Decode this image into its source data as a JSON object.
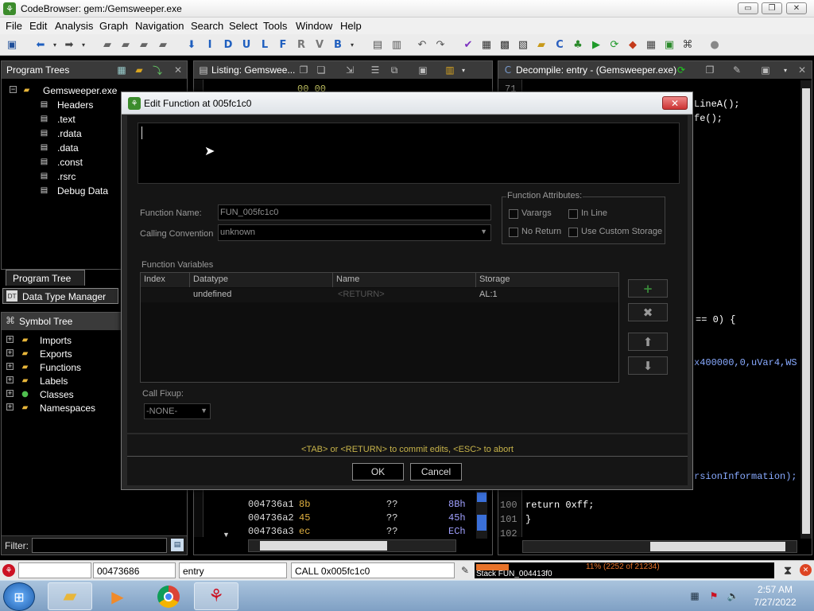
{
  "window": {
    "title": "CodeBrowser: gem:/Gemsweeper.exe",
    "buttons": {
      "minimize": "▭",
      "maximize": "❐",
      "close": "✕"
    }
  },
  "menu": [
    "File",
    "Edit",
    "Analysis",
    "Graph",
    "Navigation",
    "Search",
    "Select",
    "Tools",
    "Window",
    "Help"
  ],
  "toolbar": {
    "letters": [
      "I",
      "D",
      "U",
      "L",
      "F",
      "R",
      "V",
      "B"
    ]
  },
  "program_trees": {
    "title": "Program Trees",
    "root": "Gemsweeper.exe",
    "items": [
      "Headers",
      ".text",
      ".rdata",
      ".data",
      ".const",
      ".rsrc",
      "Debug Data"
    ],
    "tab": "Program Tree"
  },
  "data_type_manager": {
    "title": "Data Type Manager"
  },
  "symbol_tree": {
    "title": "Symbol Tree",
    "items": [
      "Imports",
      "Exports",
      "Functions",
      "Labels",
      "Classes",
      "Namespaces"
    ]
  },
  "filter": {
    "label": "Filter:",
    "value": ""
  },
  "listing": {
    "title": "Listing:  Gemswee...",
    "top_fragment": "00 00",
    "rows": [
      {
        "addr": "004736a1",
        "bytes": "8b",
        "op": "??",
        "ann": "8Bh"
      },
      {
        "addr": "004736a2",
        "bytes": "45",
        "op": "??",
        "ann": "45h"
      },
      {
        "addr": "004736a3",
        "bytes": "ec",
        "op": "??",
        "ann": "ECh"
      }
    ]
  },
  "decompile": {
    "title": "Decompile: entry -  (Gemsweeper.exe)",
    "fragments": [
      "LineA();",
      "fe();",
      "== 0) {",
      "x400000,0,uVar4,WS",
      "rsionInformation);"
    ],
    "lines": [
      {
        "num": "100",
        "code": "  return 0xff;"
      },
      {
        "num": "101",
        "code": "}"
      },
      {
        "num": "102",
        "code": ""
      }
    ],
    "top_line_num": "71"
  },
  "dialog": {
    "title": "Edit Function at 005fc1c0",
    "signature": "",
    "function_name_label": "Function Name:",
    "function_name": "FUN_005fc1c0",
    "calling_convention_label": "Calling Convention",
    "calling_convention": "unknown",
    "attributes_title": "Function Attributes:",
    "attributes": {
      "varargs": "Varargs",
      "inline": "In Line",
      "no_return": "No Return",
      "custom_storage": "Use Custom Storage"
    },
    "variables_title": "Function Variables",
    "table_headers": [
      "Index",
      "Datatype",
      "Name",
      "Storage"
    ],
    "table_rows": [
      {
        "index": "",
        "datatype": "undefined",
        "name": "<RETURN>",
        "storage": "AL:1"
      }
    ],
    "side_buttons": {
      "add": "+",
      "remove": "✖",
      "up": "⬆",
      "down": "⬇"
    },
    "call_fixup_label": "Call Fixup:",
    "call_fixup": "-NONE-",
    "hint": "<TAB> or <RETURN> to commit edits, <ESC> to abort",
    "ok": "OK",
    "cancel": "Cancel"
  },
  "statusbar": {
    "address": "00473686",
    "function": "entry",
    "instruction": "CALL 0x005fc1c0",
    "stack": "Stack FUN_004413f0",
    "memory": "11% (2252 of 21234)",
    "memory_fraction": 0.11
  },
  "taskbar": {
    "time": "2:57 AM",
    "date": "7/27/2022"
  }
}
